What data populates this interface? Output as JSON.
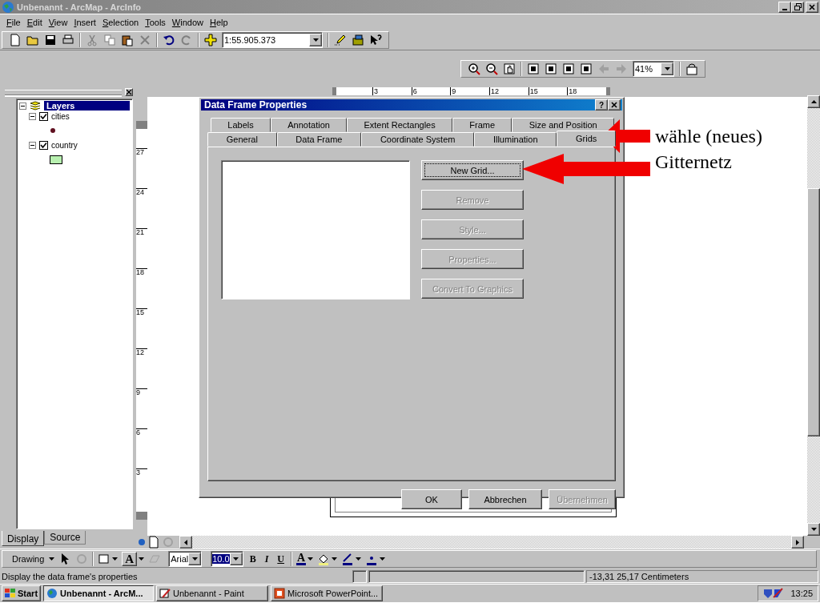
{
  "window": {
    "title": "Unbenannt - ArcMap - ArcInfo"
  },
  "menu": [
    {
      "label": "File"
    },
    {
      "label": "Edit"
    },
    {
      "label": "View"
    },
    {
      "label": "Insert"
    },
    {
      "label": "Selection"
    },
    {
      "label": "Tools"
    },
    {
      "label": "Window"
    },
    {
      "label": "Help"
    }
  ],
  "standard_toolbar": {
    "scale": "1:55.905.373"
  },
  "layout_toolbar": {
    "zoom": "41%"
  },
  "toc": {
    "root": {
      "label": "Layers",
      "selected": true,
      "expanded": true,
      "children": [
        {
          "label": "cities",
          "checked": true,
          "expanded": true,
          "kind": "point"
        },
        {
          "label": "country",
          "checked": true,
          "expanded": true,
          "kind": "polygon"
        }
      ]
    },
    "tabs": [
      {
        "label": "Display",
        "selected": true
      },
      {
        "label": "Source",
        "selected": false
      }
    ]
  },
  "ruler": {
    "horizontal": [
      "3",
      "6",
      "9",
      "12",
      "15",
      "18"
    ],
    "vertical": [
      "27",
      "24",
      "21",
      "18",
      "15",
      "12",
      "9",
      "6",
      "3"
    ]
  },
  "dialog": {
    "title": "Data Frame Properties",
    "help": "?",
    "tab_rows": [
      [
        {
          "label": "Labels",
          "selected": false
        },
        {
          "label": "Annotation",
          "selected": false
        },
        {
          "label": "Extent Rectangles",
          "selected": false
        },
        {
          "label": "Frame",
          "selected": false
        },
        {
          "label": "Size and Position",
          "selected": false
        }
      ],
      [
        {
          "label": "General",
          "selected": false
        },
        {
          "label": "Data Frame",
          "selected": false
        },
        {
          "label": "Coordinate System",
          "selected": false
        },
        {
          "label": "Illumination",
          "selected": false
        },
        {
          "label": "Grids",
          "selected": true
        }
      ]
    ],
    "grid_buttons": [
      {
        "label": "New Grid...",
        "disabled": false
      },
      {
        "label": "Remove",
        "disabled": true
      },
      {
        "label": "Style...",
        "disabled": true
      },
      {
        "label": "Properties...",
        "disabled": true
      },
      {
        "label": "Convert To Graphics",
        "disabled": true
      }
    ],
    "footer_buttons": [
      {
        "label": "OK",
        "disabled": false
      },
      {
        "label": "Abbrechen",
        "disabled": false
      },
      {
        "label": "Übernehmen",
        "disabled": true
      }
    ]
  },
  "annotations": [
    "wähle (neues)",
    "Gitternetz"
  ],
  "drawing_toolbar": {
    "label": "Drawing",
    "text_tool": "A",
    "font": "Arial",
    "size": "10.0",
    "format_buttons": [
      "B",
      "I",
      "U"
    ],
    "font_color": "A"
  },
  "status_bar": {
    "message": "Display the data frame's properties",
    "coordinates": "-13,31  25,17 Centimeters"
  },
  "taskbar": {
    "start": "Start",
    "tasks": [
      {
        "label": "Unbenannt - ArcM...",
        "selected": true
      },
      {
        "label": "Unbenannt - Paint",
        "selected": false
      },
      {
        "label": "Microsoft PowerPoint...",
        "selected": false
      }
    ],
    "clock": "13:25"
  }
}
